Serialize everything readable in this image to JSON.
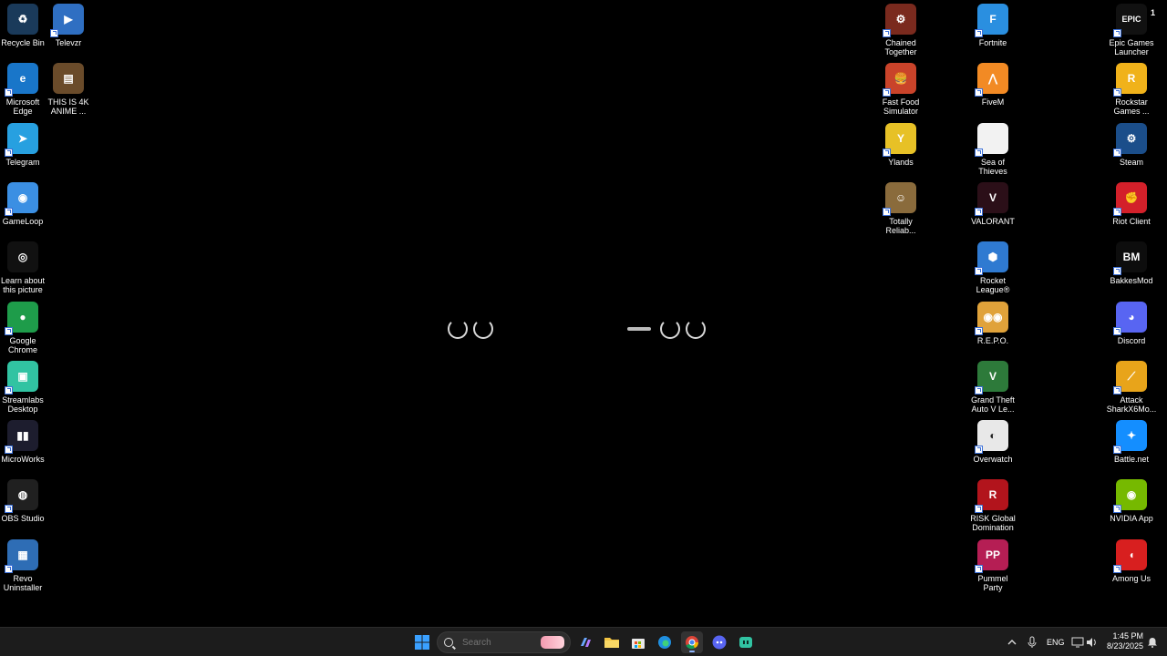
{
  "desktop": {
    "icons": [
      {
        "label": "Recycle Bin",
        "icon": "recycle-bin-icon",
        "color": "#1a3a5a",
        "glyph": "♻",
        "shortcut": false
      },
      {
        "label": "Televzr",
        "icon": "televzr-icon",
        "color": "#2f6fc2",
        "glyph": "▶",
        "shortcut": true
      },
      {
        "label": "Microsoft\nEdge",
        "icon": "edge-icon",
        "color": "#1976c9",
        "glyph": "e",
        "shortcut": true
      },
      {
        "label": "THIS IS 4K\nANIME ...",
        "icon": "video-file-icon",
        "color": "#6a4b2a",
        "glyph": "▤",
        "shortcut": false
      },
      {
        "label": "Telegram",
        "icon": "telegram-icon",
        "color": "#27a0e0",
        "glyph": "➤",
        "shortcut": true
      },
      {
        "label": "GameLoop",
        "icon": "gameloop-icon",
        "color": "#3b8fe3",
        "glyph": "◉",
        "shortcut": true
      },
      {
        "label": "Learn about\nthis picture",
        "icon": "learn-picture-icon",
        "color": "#111111",
        "glyph": "◎",
        "shortcut": false
      },
      {
        "label": "Google\nChrome",
        "icon": "chrome-icon",
        "color": "#1e9c4a",
        "glyph": "●",
        "shortcut": true
      },
      {
        "label": "Streamlabs\nDesktop",
        "icon": "streamlabs-icon",
        "color": "#31c3a2",
        "glyph": "▣",
        "shortcut": true
      },
      {
        "label": "MicroWorks",
        "icon": "microworks-icon",
        "color": "#1d1d2e",
        "glyph": "▮▮",
        "shortcut": true
      },
      {
        "label": "OBS Studio",
        "icon": "obs-icon",
        "color": "#202020",
        "glyph": "◍",
        "shortcut": true
      },
      {
        "label": "Revo\nUninstaller",
        "icon": "revo-uninstaller-icon",
        "color": "#2e6db5",
        "glyph": "▦",
        "shortcut": true
      },
      {
        "label": "Chained\nTogether",
        "icon": "chained-together-icon",
        "color": "#7a2a1e",
        "glyph": "⚙",
        "shortcut": true
      },
      {
        "label": "Fast Food\nSimulator",
        "icon": "fast-food-simulator-icon",
        "color": "#c9432a",
        "glyph": "🍔",
        "shortcut": true
      },
      {
        "label": "Ylands",
        "icon": "ylands-icon",
        "color": "#e7c126",
        "glyph": "Y",
        "shortcut": true
      },
      {
        "label": "Totally\nReliab...",
        "icon": "totally-reliable-icon",
        "color": "#8a6b3c",
        "glyph": "☺",
        "shortcut": true
      },
      {
        "label": "Fortnite",
        "icon": "fortnite-icon",
        "color": "#2a8fe0",
        "glyph": "F",
        "shortcut": true
      },
      {
        "label": "FiveM",
        "icon": "fivem-icon",
        "color": "#f28a24",
        "glyph": "⋀",
        "shortcut": true
      },
      {
        "label": "Sea of\nThieves",
        "icon": "sea-of-thieves-icon",
        "color": "#f2f2f2",
        "glyph": "",
        "shortcut": true
      },
      {
        "label": "VALORANT",
        "icon": "valorant-icon",
        "color": "#2b0f18",
        "glyph": "V",
        "shortcut": true
      },
      {
        "label": "Rocket\nLeague®",
        "icon": "rocket-league-icon",
        "color": "#2f7ad1",
        "glyph": "⬢",
        "shortcut": true
      },
      {
        "label": "R.E.P.O.",
        "icon": "repo-icon",
        "color": "#e0a23a",
        "glyph": "◉◉",
        "shortcut": true
      },
      {
        "label": "Grand Theft\nAuto V Le...",
        "icon": "gta-v-icon",
        "color": "#2d7a3a",
        "glyph": "V",
        "shortcut": true
      },
      {
        "label": "Overwatch",
        "icon": "overwatch-icon",
        "color": "#e8e8e8",
        "glyph": "◐",
        "shortcut": true
      },
      {
        "label": "RISK Global\nDomination",
        "icon": "risk-icon",
        "color": "#b2141c",
        "glyph": "R",
        "shortcut": true
      },
      {
        "label": "Pummel\nParty",
        "icon": "pummel-party-icon",
        "color": "#b51e54",
        "glyph": "PP",
        "shortcut": true
      },
      {
        "label": "Epic Games\nLauncher",
        "icon": "epic-games-icon",
        "color": "#111111",
        "glyph": "EPIC",
        "shortcut": true
      },
      {
        "label": "Rockstar\nGames ...",
        "icon": "rockstar-icon",
        "color": "#f0b21a",
        "glyph": "R",
        "shortcut": true
      },
      {
        "label": "Steam",
        "icon": "steam-icon",
        "color": "#1b4e8a",
        "glyph": "⚙",
        "shortcut": true
      },
      {
        "label": "Riot Client",
        "icon": "riot-client-icon",
        "color": "#d3202a",
        "glyph": "✊",
        "shortcut": true
      },
      {
        "label": "BakkesMod",
        "icon": "bakkesmod-icon",
        "color": "#0d0d0d",
        "glyph": "BM",
        "shortcut": true
      },
      {
        "label": "Discord",
        "icon": "discord-icon",
        "color": "#5865f2",
        "glyph": "◕",
        "shortcut": true
      },
      {
        "label": "Attack\nSharkX6Mo...",
        "icon": "attack-shark-icon",
        "color": "#e8a41a",
        "glyph": "⟋",
        "shortcut": true
      },
      {
        "label": "Battle.net",
        "icon": "battlenet-icon",
        "color": "#148eff",
        "glyph": "✦",
        "shortcut": true
      },
      {
        "label": "NVIDIA App",
        "icon": "nvidia-app-icon",
        "color": "#76b900",
        "glyph": "◉",
        "shortcut": true
      },
      {
        "label": "Among Us",
        "icon": "among-us-icon",
        "color": "#d81f1f",
        "glyph": "◖",
        "shortcut": true
      }
    ],
    "corner_badge": "1"
  },
  "taskbar": {
    "search_placeholder": "Search",
    "apps": [
      {
        "name": "start-button",
        "icon": "windows-start-icon",
        "color": "#3aa0ff"
      },
      {
        "name": "copilot-button",
        "icon": "copilot-icon",
        "color": "#5fa2ff"
      },
      {
        "name": "file-explorer-button",
        "icon": "folder-icon",
        "color": "#f4c542"
      },
      {
        "name": "store-button",
        "icon": "store-icon",
        "color": "#3b7fd9"
      },
      {
        "name": "edge-taskbar-button",
        "icon": "edge-icon",
        "color": "#1f8fe0"
      },
      {
        "name": "chrome-taskbar-button",
        "icon": "chrome-icon",
        "color": "#2da14b"
      },
      {
        "name": "discord-taskbar-button",
        "icon": "discord-icon",
        "color": "#5865f2"
      },
      {
        "name": "streamlabs-taskbar-button",
        "icon": "streamlabs-icon",
        "color": "#31c3a2"
      }
    ],
    "tray": {
      "language": "ENG",
      "time": "1:45 PM",
      "date": "8/23/2025"
    }
  }
}
